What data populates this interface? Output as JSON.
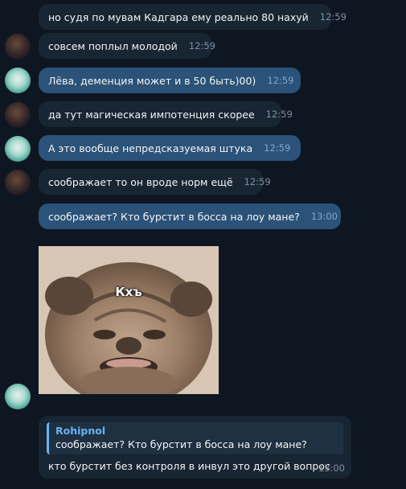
{
  "messages": [
    {
      "text": "но судя по мувам Кадгара ему реально 80 нахуй",
      "time": "12:59"
    },
    {
      "text": "совсем поплыл молодой",
      "time": "12:59"
    },
    {
      "text": "Лёва, деменция может и в 50 быть)00)",
      "time": "12:59"
    },
    {
      "text": "да тут магическая импотенция скорее",
      "time": "12:59"
    },
    {
      "text": "А это вообще непредсказуемая штука",
      "time": "12:59"
    },
    {
      "text": "соображает то он вроде норм ещё",
      "time": "12:59"
    },
    {
      "text": "соображает? Кто бурстит в босса на лоу мане?",
      "time": "13:00"
    }
  ],
  "sticker": {
    "caption": "Кхъ"
  },
  "reply": {
    "quote_author": "Rohipnol",
    "quote_text": "соображает? Кто бурстит в босса на лоу мане?",
    "text": "кто бурстит без контроля в инвул это другой вопрос",
    "time": "13:00"
  },
  "colors": {
    "background": "#0e1621",
    "incoming_bubble": "#182533",
    "outgoing_bubble": "#2b5278",
    "accent": "#6ab3f3"
  },
  "icons": {
    "read_receipt": "double-check-icon"
  }
}
